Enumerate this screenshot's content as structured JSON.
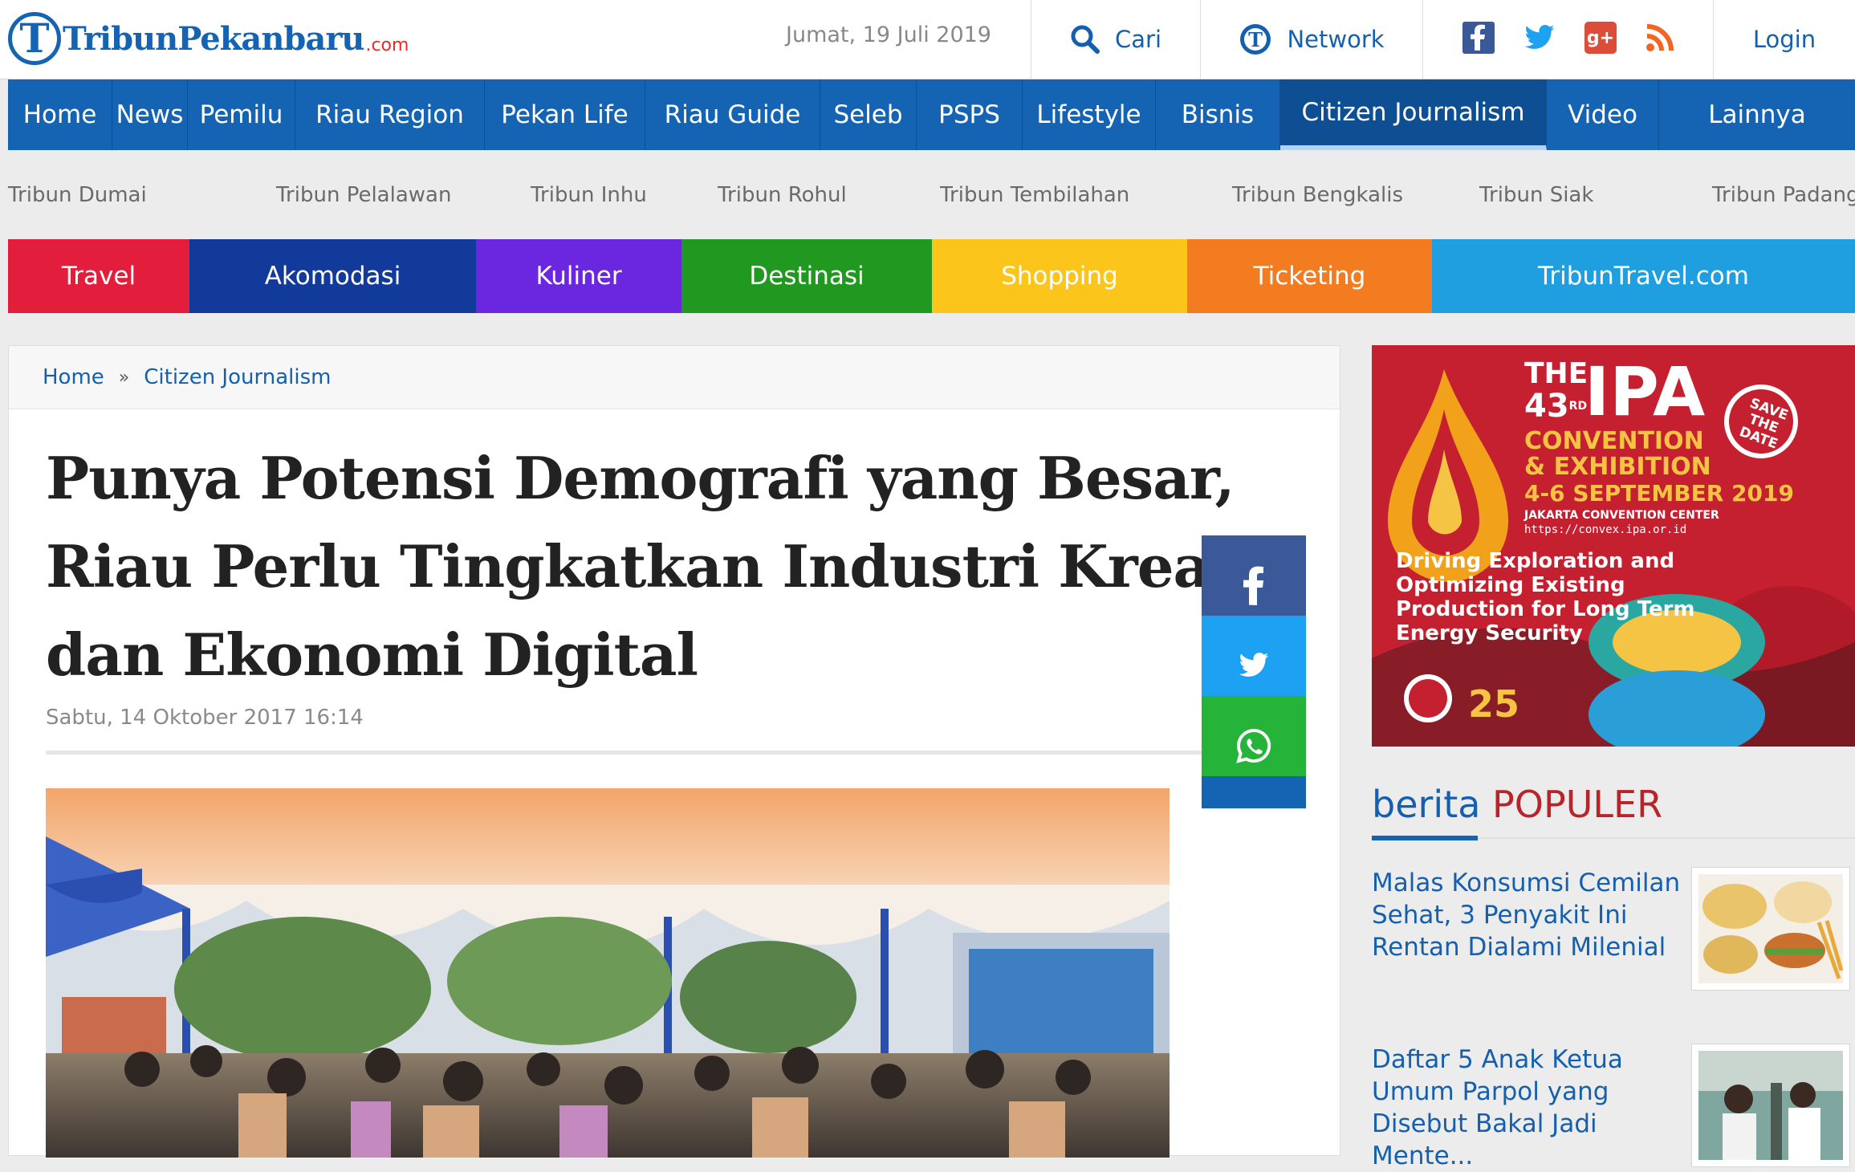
{
  "site": {
    "logo_name": "TribunPekanbaru",
    "logo_domain": ".com"
  },
  "header": {
    "date": "Jumat, 19 Juli 2019",
    "search_label": "Cari",
    "network_label": "Network",
    "login_label": "Login",
    "social_icons": [
      "facebook-icon",
      "twitter-icon",
      "google-plus-icon",
      "rss-icon"
    ]
  },
  "nav": {
    "items": [
      "Home",
      "News",
      "Pemilu",
      "Riau Region",
      "Pekan Life",
      "Riau Guide",
      "Seleb",
      "PSPS",
      "Lifestyle",
      "Bisnis",
      "Citizen Journalism",
      "Video",
      "Lainnya"
    ],
    "active": "Citizen Journalism"
  },
  "regions": [
    "Tribun Dumai",
    "Tribun Pelalawan",
    "Tribun Inhu",
    "Tribun Rohul",
    "Tribun Tembilahan",
    "Tribun Bengkalis",
    "Tribun Siak",
    "Tribun Padang"
  ],
  "travel": [
    {
      "label": "Travel",
      "color": "#e31e3c"
    },
    {
      "label": "Akomodasi",
      "color": "#123a9a"
    },
    {
      "label": "Kuliner",
      "color": "#6b27e0"
    },
    {
      "label": "Destinasi",
      "color": "#21981f"
    },
    {
      "label": "Shopping",
      "color": "#fbc51b"
    },
    {
      "label": "Ticketing",
      "color": "#f47c20"
    },
    {
      "label": "TribunTravel.com",
      "color": "#1f9ee0"
    }
  ],
  "breadcrumb": {
    "home": "Home",
    "separator": "»",
    "section": "Citizen Journalism"
  },
  "article": {
    "title_lines": [
      "Punya Potensi Demografi yang Besar,",
      "Riau Perlu Tingkatkan Industri Kreatif",
      "dan Ekonomi Digital"
    ],
    "date": "Sabtu, 14 Oktober 2017 16:14"
  },
  "share": [
    {
      "name": "share-facebook-button",
      "icon": "facebook-icon",
      "color": "#3b5998"
    },
    {
      "name": "share-twitter-button",
      "icon": "twitter-icon",
      "color": "#1da1f2"
    },
    {
      "name": "share-whatsapp-button",
      "icon": "whatsapp-icon",
      "color": "#25b33a"
    }
  ],
  "ad": {
    "the": "THE",
    "edition": "43",
    "edition_suffix": "RD",
    "brand": "IPA",
    "line1": "CONVENTION",
    "line2": "& EXHIBITION",
    "dates": "4-6 SEPTEMBER 2019",
    "venue": "JAKARTA CONVENTION CENTER",
    "url": "https://convex.ipa.or.id",
    "tagline": [
      "Driving Exploration and",
      "Optimizing Existing",
      "Production for Long Term",
      "Energy Security"
    ],
    "badge": [
      "SAVE",
      "THE",
      "DATE"
    ],
    "anniversary": "25"
  },
  "popular": {
    "heading_1": "berita",
    "heading_2": "POPULER",
    "items": [
      {
        "title": "Malas Konsumsi Cemilan Sehat, 3 Penyakit Ini Rentan Dialami Milenial"
      },
      {
        "title": "Daftar 5 Anak Ketua Umum Parpol yang Disebut Bakal Jadi Mente..."
      }
    ]
  }
}
